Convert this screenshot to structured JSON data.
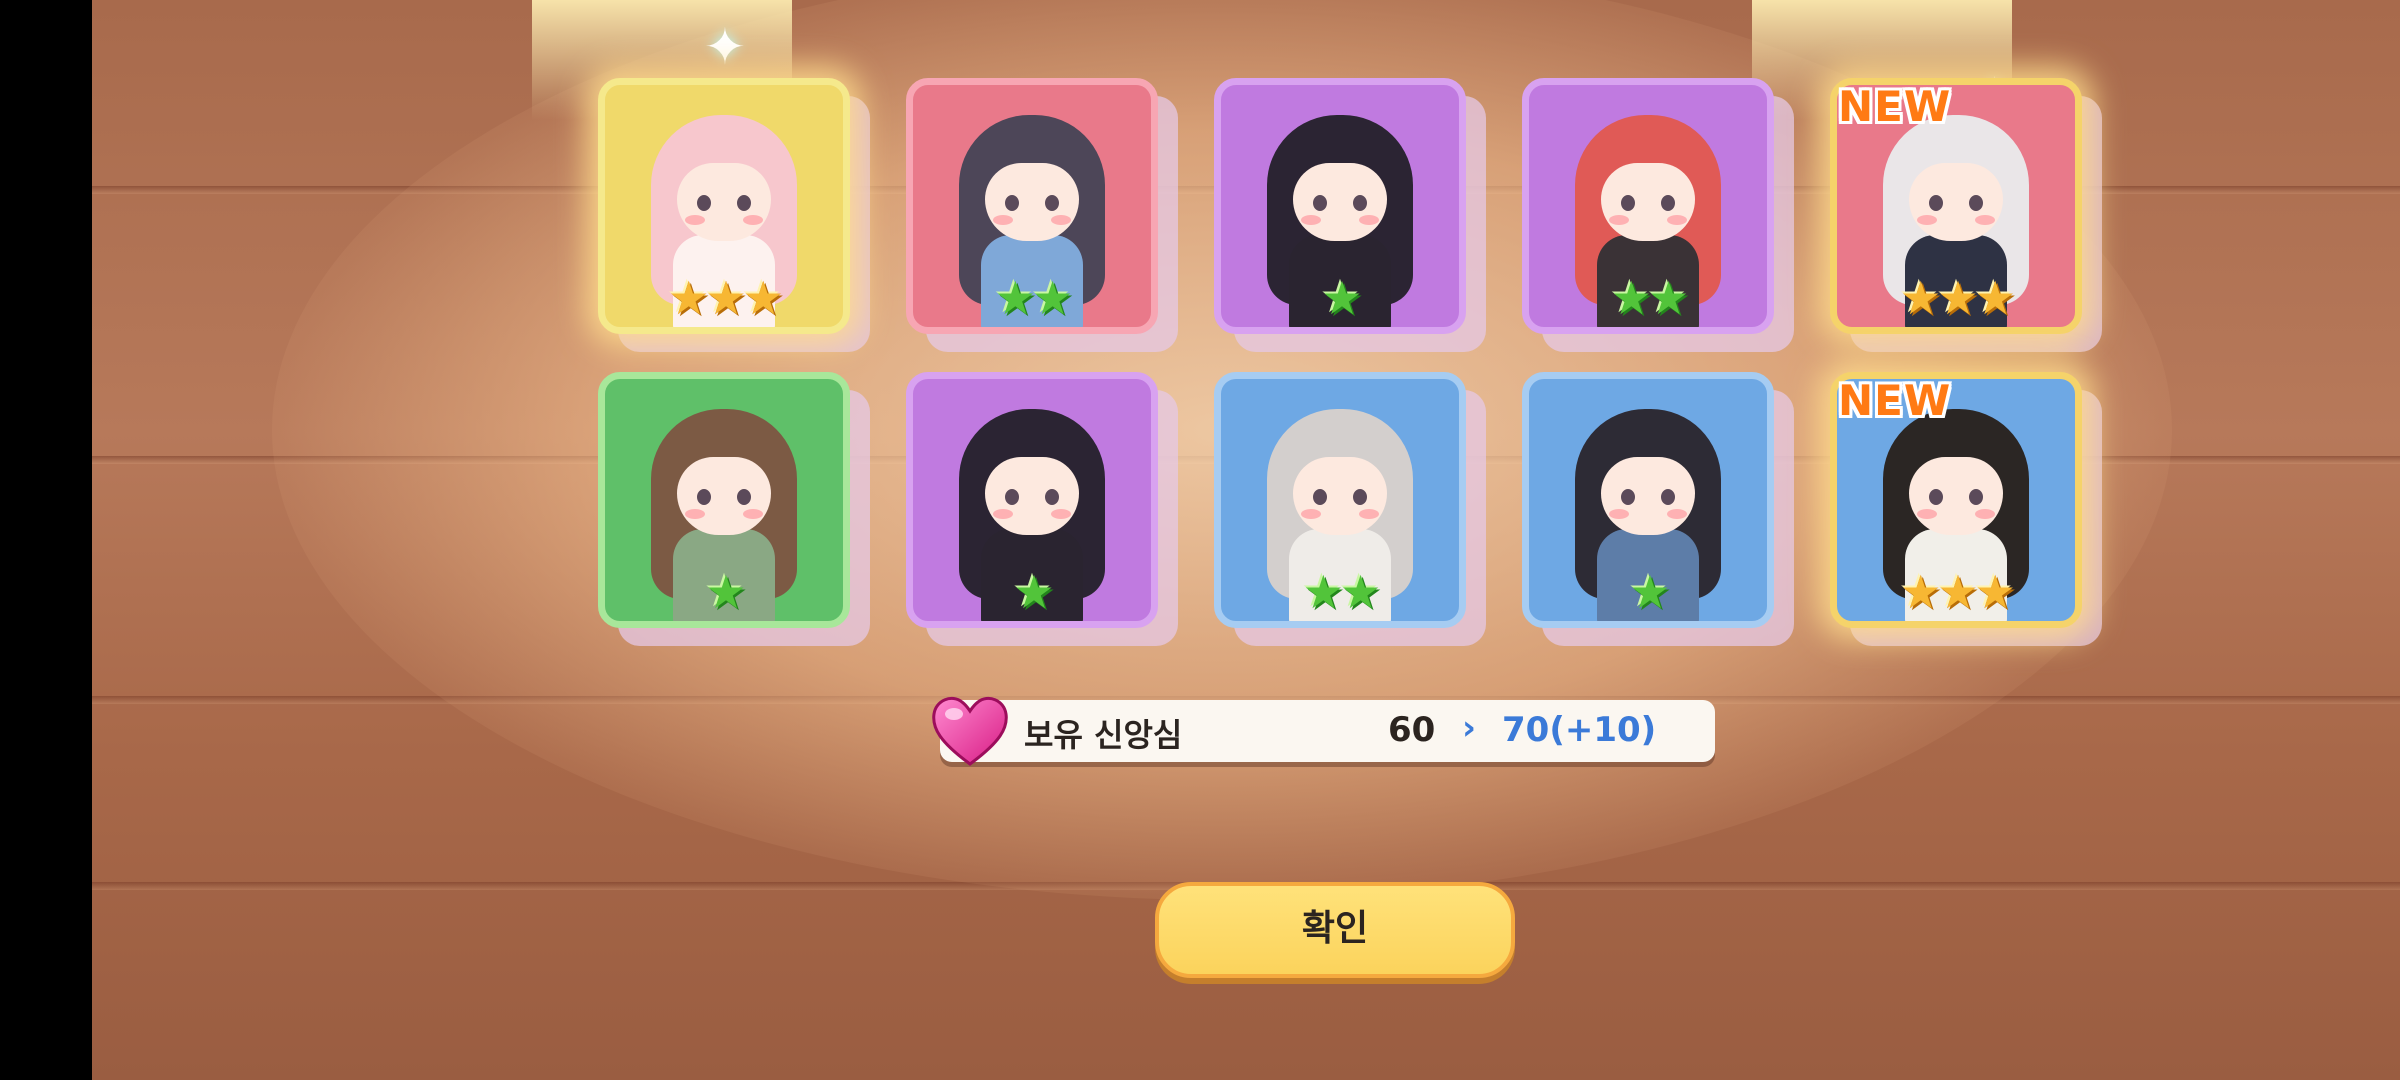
{
  "results": {
    "cards": [
      {
        "stars": 3,
        "star_color": "gold",
        "bg": "#f0d96a",
        "border": "#f5e98c",
        "hair": "#f7c7cd",
        "outfit": "#fdf2ef",
        "new": false,
        "glow": true
      },
      {
        "stars": 2,
        "star_color": "green",
        "bg": "#e9798a",
        "border": "#f7a6b3",
        "hair": "#4d4658",
        "outfit": "#7fa8d8",
        "new": false,
        "glow": false
      },
      {
        "stars": 1,
        "star_color": "green",
        "bg": "#c07ae0",
        "border": "#d8a2f0",
        "hair": "#2b2433",
        "outfit": "#2a2430",
        "new": false,
        "glow": false
      },
      {
        "stars": 2,
        "star_color": "green",
        "bg": "#c07ae0",
        "border": "#d8a2f0",
        "hair": "#e05a56",
        "outfit": "#3a3236",
        "new": false,
        "glow": false
      },
      {
        "stars": 3,
        "star_color": "gold",
        "bg": "#e9798a",
        "border": "#f5d36a",
        "hair": "#eae6e8",
        "outfit": "#2e3244",
        "new": true,
        "glow": true
      },
      {
        "stars": 1,
        "star_color": "green",
        "bg": "#5fc069",
        "border": "#a8e79a",
        "hair": "#7c5a44",
        "outfit": "#8aa884",
        "new": false,
        "glow": false
      },
      {
        "stars": 1,
        "star_color": "green",
        "bg": "#c07ae0",
        "border": "#d8a2f0",
        "hair": "#2b2433",
        "outfit": "#2a2430",
        "new": false,
        "glow": false
      },
      {
        "stars": 2,
        "star_color": "green",
        "bg": "#6ea8e4",
        "border": "#a6ccf2",
        "hair": "#d3cfcd",
        "outfit": "#efece8",
        "new": false,
        "glow": false
      },
      {
        "stars": 1,
        "star_color": "green",
        "bg": "#6ea8e4",
        "border": "#a6ccf2",
        "hair": "#2d2b35",
        "outfit": "#5d7da8",
        "new": false,
        "glow": false
      },
      {
        "stars": 3,
        "star_color": "gold",
        "bg": "#6ea8e4",
        "border": "#f5d36a",
        "hair": "#2b2624",
        "outfit": "#f1efe9",
        "new": true,
        "glow": true
      }
    ],
    "new_label": "NEW"
  },
  "faith": {
    "icon": "heart-icon",
    "label": "보유 신앙심",
    "current": "60",
    "arrow": "›",
    "new_value": "70(+10)"
  },
  "confirm": {
    "label": "확인"
  }
}
